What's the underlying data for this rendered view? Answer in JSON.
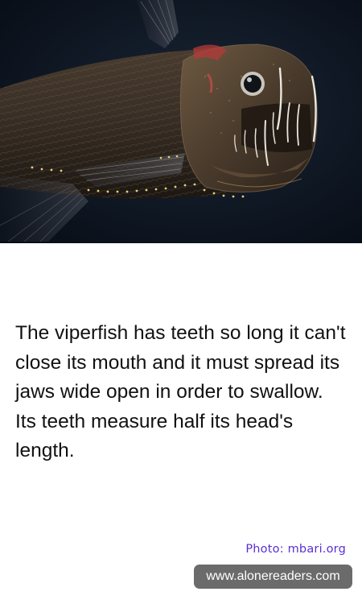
{
  "photo": {
    "subject": "viperfish"
  },
  "fact": {
    "text": "The viperfish has teeth so long it can't close its mouth and it must spread its jaws wide open in order to swallow. Its teeth measure half its head's length."
  },
  "credit": {
    "text": "Photo: mbari.org"
  },
  "site": {
    "url": "www.alonereaders.com"
  },
  "colors": {
    "background": "#ffffff",
    "photo_background": "#0d1722",
    "text": "#111111",
    "credit": "#5a2fd0",
    "badge": "#6b6b6b"
  }
}
